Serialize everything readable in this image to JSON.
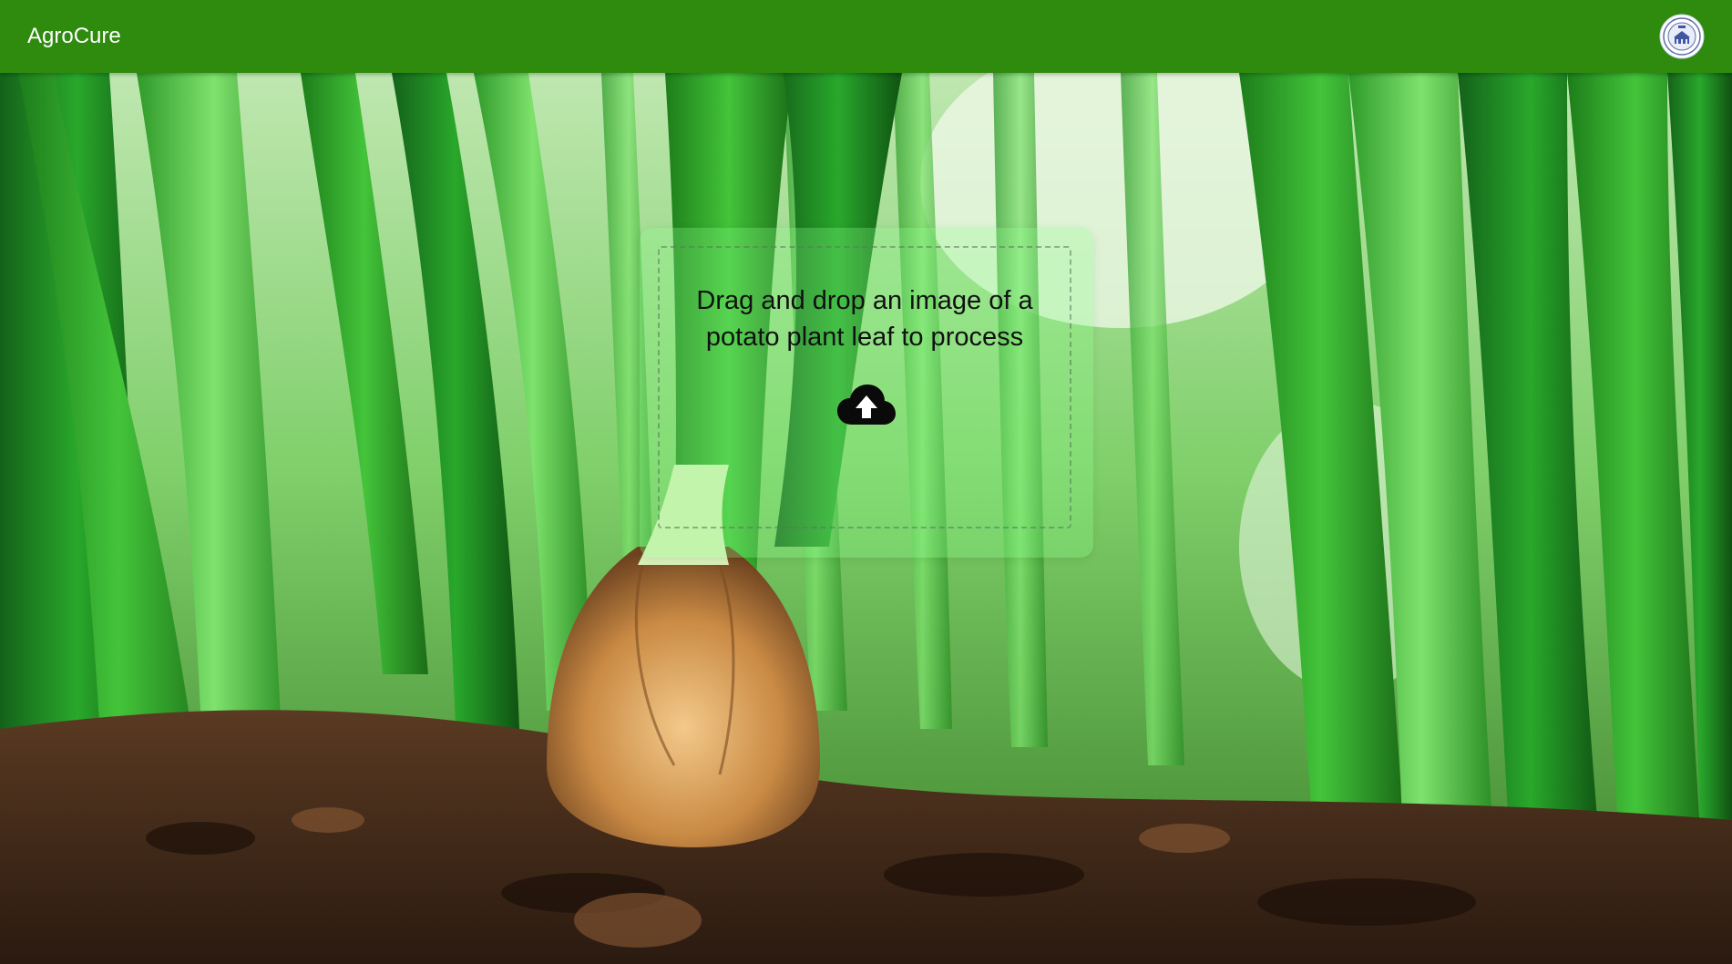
{
  "header": {
    "app_title": "AgroCure",
    "logo_icon": "university-seal-logo"
  },
  "upload": {
    "instruction": "Drag and drop an image of a potato plant leaf to process",
    "icon": "cloud-upload-icon"
  },
  "colors": {
    "appbar": "#2e8b0e",
    "card_tint": "#8cff8c"
  }
}
